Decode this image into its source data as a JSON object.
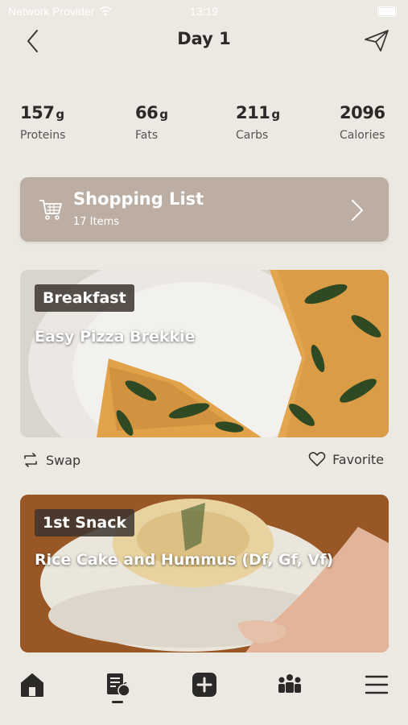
{
  "status_bar": {
    "carrier": "Network Provider",
    "time": "13:19"
  },
  "header": {
    "title": "Day 1"
  },
  "macros": [
    {
      "value": "157",
      "unit": "g",
      "label": "Proteins"
    },
    {
      "value": "66",
      "unit": "g",
      "label": "Fats"
    },
    {
      "value": "211",
      "unit": "g",
      "label": "Carbs"
    },
    {
      "value": "2096",
      "unit": "",
      "label": "Calories"
    }
  ],
  "shopping_list": {
    "title": "Shopping List",
    "count": "17 Items"
  },
  "meals": [
    {
      "tag": "Breakfast",
      "name": "Easy Pizza Brekkie"
    },
    {
      "tag": "1st Snack",
      "name": "Rice Cake and Hummus (Df, Gf, Vf)"
    }
  ],
  "actions": {
    "swap_label": "Swap",
    "favorite_label": "Favorite"
  },
  "tabbar": {
    "items": [
      "home-icon",
      "meal-plan-icon",
      "add-icon",
      "community-icon",
      "menu-icon"
    ],
    "active": "meal-plan-icon"
  },
  "colors": {
    "background": "#ece9e3",
    "shopping_card": "#bcaea3",
    "tag_bg": "#3c342e"
  }
}
